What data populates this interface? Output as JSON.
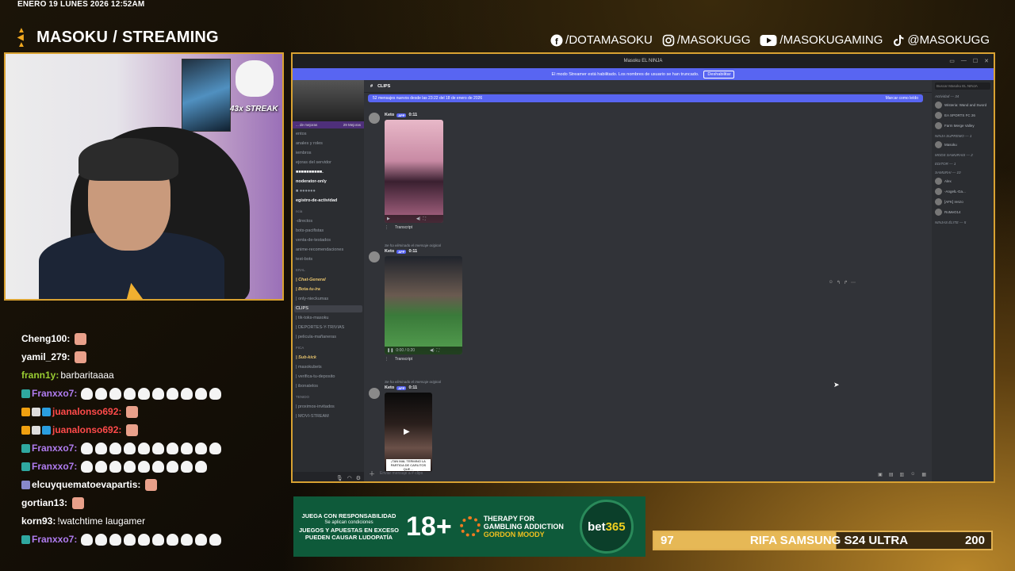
{
  "overlay": {
    "datetime": "ENERO 19 LUNES 2026 12:52AM",
    "brand_left": "MASOKU",
    "brand_slash": "/",
    "brand_right": "STREAMING",
    "socials": [
      {
        "icon": "facebook-icon",
        "label": "/DOTAMASOKU"
      },
      {
        "icon": "instagram-icon",
        "label": "/MASOKUGG"
      },
      {
        "icon": "youtube-icon",
        "label": "/MASOKUGAMING"
      },
      {
        "icon": "tiktok-icon",
        "label": "@MASOKUGG"
      }
    ],
    "streak": "43x STREAK",
    "accent_color": "#d9a232"
  },
  "chat": [
    {
      "user": "Cheng100:",
      "color": "#ffffff",
      "text": "",
      "emotes": 1,
      "emote_type": "face",
      "badges": []
    },
    {
      "user": "yamil_279:",
      "color": "#ffffff",
      "text": "",
      "emotes": 1,
      "emote_type": "face",
      "badges": []
    },
    {
      "user": "frann1y:",
      "color": "#9acd32",
      "text": "barbaritaaaa",
      "emotes": 0,
      "emote_type": "",
      "badges": []
    },
    {
      "user": "Franxxo7:",
      "color": "#b07cf0",
      "text": "",
      "emotes": 10,
      "emote_type": "dog",
      "badges": [
        "#2fa8a0"
      ]
    },
    {
      "user": "juanalonso692:",
      "color": "#ff4a4a",
      "text": "",
      "emotes": 1,
      "emote_type": "face",
      "badges": [
        "#f0a010",
        "#dddddd",
        "#2a9ee0"
      ]
    },
    {
      "user": "juanalonso692:",
      "color": "#ff4a4a",
      "text": "",
      "emotes": 1,
      "emote_type": "face",
      "badges": [
        "#f0a010",
        "#dddddd",
        "#2a9ee0"
      ]
    },
    {
      "user": "Franxxo7:",
      "color": "#b07cf0",
      "text": "",
      "emotes": 10,
      "emote_type": "dog",
      "badges": [
        "#2fa8a0"
      ]
    },
    {
      "user": "Franxxo7:",
      "color": "#b07cf0",
      "text": "",
      "emotes": 9,
      "emote_type": "dog",
      "badges": [
        "#2fa8a0"
      ]
    },
    {
      "user": "elcuyquematoevapartis:",
      "color": "#ffffff",
      "text": "",
      "emotes": 1,
      "emote_type": "face",
      "badges": [
        "#8888cc"
      ]
    },
    {
      "user": "gortian13:",
      "color": "#ffffff",
      "text": "",
      "emotes": 1,
      "emote_type": "face",
      "badges": []
    },
    {
      "user": "korn93:",
      "color": "#ffffff",
      "text": "!watchtime laugamer",
      "emotes": 0,
      "emote_type": "",
      "badges": []
    },
    {
      "user": "Franxxo7:",
      "color": "#b07cf0",
      "text": "",
      "emotes": 10,
      "emote_type": "dog",
      "badges": [
        "#2fa8a0"
      ]
    }
  ],
  "discord": {
    "window_title": "Masoku EL NINJA",
    "notice": "El modo Streamer está habilitado. Los nombres de usuario se han truncado.",
    "notice_button": "Deshabilitar",
    "server_name": "Masoku EL NINJA",
    "boost": "... de mejoras",
    "boost_count": "29 Mejoras",
    "channels": [
      {
        "name": "entos",
        "style": ""
      },
      {
        "name": "anales y roles",
        "style": ""
      },
      {
        "name": "iembros",
        "style": ""
      },
      {
        "name": "ejoras del servidor",
        "style": ""
      },
      {
        "name": "■■■■■■■■■■.",
        "style": "bold"
      },
      {
        "name": "noderator-only",
        "style": "bold"
      },
      {
        "name": "■ ●●●●●●",
        "style": ""
      },
      {
        "name": "egistro-de-actividad",
        "style": "bold"
      },
      {
        "name": "ncia",
        "style": "cat"
      },
      {
        "name": "-directos",
        "style": ""
      },
      {
        "name": "bots-pacifistas",
        "style": ""
      },
      {
        "name": "venta-de-testados",
        "style": ""
      },
      {
        "name": "anime-recomendaciones",
        "style": ""
      },
      {
        "name": "test-bots",
        "style": ""
      },
      {
        "name": "ERAL",
        "style": "cat"
      },
      {
        "name": "| Chat-General",
        "style": "gold"
      },
      {
        "name": "| Bota-tu-ira",
        "style": "gold"
      },
      {
        "name": "| only-nieckumas",
        "style": ""
      },
      {
        "name": "CLIPS",
        "style": "active"
      },
      {
        "name": "| tik-toks-masoku",
        "style": ""
      },
      {
        "name": "| DEPORTES-Y-TRIVIAS",
        "style": ""
      },
      {
        "name": "| pelicula-mañaneras",
        "style": ""
      },
      {
        "name": "FICA",
        "style": "cat"
      },
      {
        "name": "| Sub-kick",
        "style": "gold"
      },
      {
        "name": "| masokubets",
        "style": ""
      },
      {
        "name": "| verifica-tu-deposito",
        "style": ""
      },
      {
        "name": "| ibonatelos",
        "style": ""
      },
      {
        "name": "TENIDO",
        "style": "cat"
      },
      {
        "name": "| proximos-invitados",
        "style": ""
      },
      {
        "name": "| MOVI-STREAM",
        "style": ""
      }
    ],
    "channel": "CLIPS",
    "new_messages": "52 mensajes nuevos desde las 23:22 del 18 de enero de 2026",
    "mark_read": "Marcar como leído",
    "posts": [
      {
        "deleted": "",
        "author": "Keto",
        "badge": "APP",
        "time": "0:11",
        "progress": "",
        "transcript": "Transcript",
        "caption": ""
      },
      {
        "deleted": "Se ha eliminado el mensaje original",
        "author": "Keto",
        "badge": "APP",
        "time": "0:11",
        "progress": "0:00 / 0:20",
        "transcript": "Transcript",
        "caption": ""
      },
      {
        "deleted": "Se ha eliminado el mensaje original",
        "author": "Keto",
        "badge": "APP",
        "time": "0:11",
        "progress": "",
        "transcript": "",
        "caption": "¡TAN MAL TERMINO LA PARTIDA DE CARLITOS QUE…"
      }
    ],
    "composer_placeholder": "Enviar mensaje a # clips",
    "member_search": "Buscar Masoku EL NINJA",
    "members": [
      {
        "text": "Actividad — 34",
        "type": "role"
      },
      {
        "text": "Wisteria: Wand and Sword",
        "type": "member"
      },
      {
        "text": "EA SPORTS FC 26",
        "type": "member"
      },
      {
        "text": "Farm Merge Valley",
        "type": "member"
      },
      {
        "text": "NINJA SUPREMO — 1",
        "type": "role"
      },
      {
        "text": "Masoku",
        "type": "member"
      },
      {
        "text": "MODS SAMURAIS — 2",
        "type": "role"
      },
      {
        "text": "EDITOR — 1",
        "type": "role"
      },
      {
        "text": "SAMURAI — 10",
        "type": "role"
      },
      {
        "text": "Alex",
        "type": "member"
      },
      {
        "text": "-AngelL-Ga...",
        "type": "member"
      },
      {
        "text": "[AFK] renzo",
        "type": "member"
      },
      {
        "text": "RoMeO14",
        "type": "member"
      },
      {
        "text": "NINJAS ÉLITE — 5",
        "type": "role"
      }
    ]
  },
  "ad": {
    "left_line1": "JUEGA CON RESPONSABILIDAD",
    "left_line2": "Se aplican condiciones",
    "left_line3": "JUEGOS Y APUESTAS EN EXCESO",
    "left_line4": "PUEDEN CAUSAR LUDOPATÍA",
    "age": "18+",
    "therapy1": "THERAPY FOR",
    "therapy2": "GAMBLING ADDICTION",
    "therapy3": "GORDON MOODY",
    "brand_a": "bet",
    "brand_b": "365"
  },
  "raffle": {
    "current": "97",
    "title": "RIFA SAMSUNG S24 ULTRA",
    "goal": "200"
  }
}
